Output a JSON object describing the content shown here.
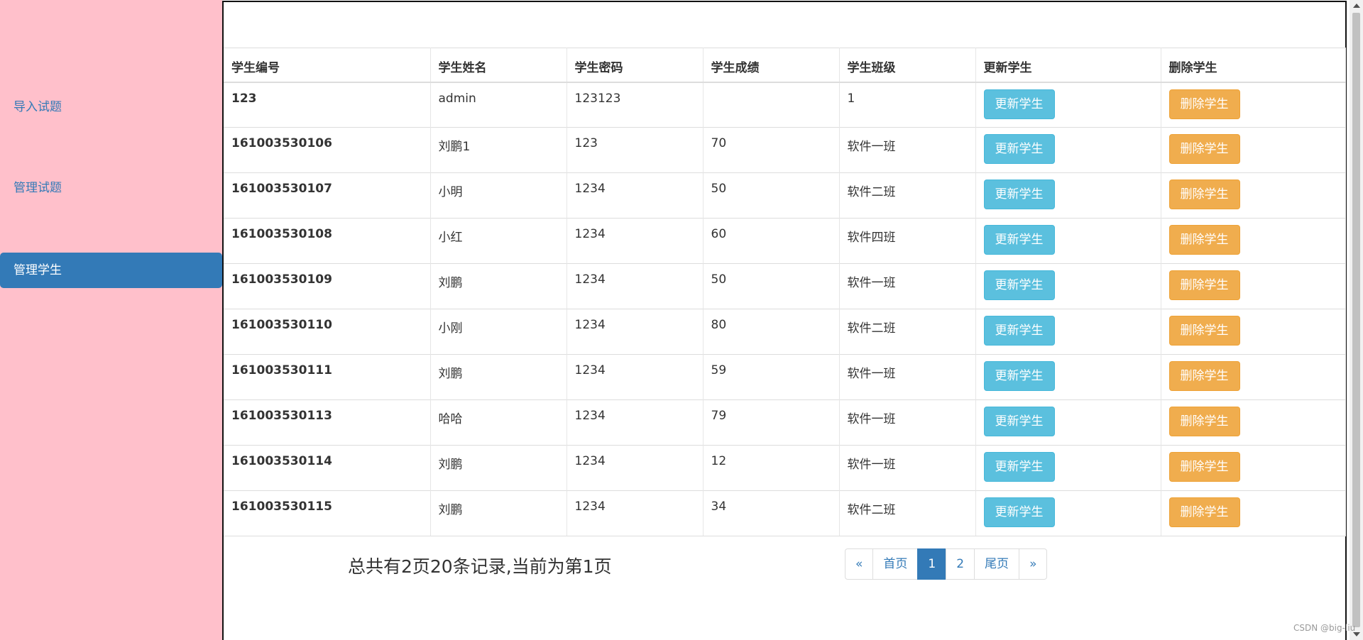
{
  "sidebar": {
    "items": [
      {
        "label": "导入试题"
      },
      {
        "label": "管理试题"
      },
      {
        "label": "管理学生",
        "active": true
      }
    ]
  },
  "table": {
    "headers": [
      "学生编号",
      "学生姓名",
      "学生密码",
      "学生成绩",
      "学生班级",
      "更新学生",
      "删除学生"
    ],
    "rows": [
      {
        "id": "123",
        "name": "admin",
        "password": "123123",
        "score": "",
        "class": "1",
        "update_label": "更新学生",
        "delete_label": "删除学生"
      },
      {
        "id": "161003530106",
        "name": "刘鹏1",
        "password": "123",
        "score": "70",
        "class": "软件一班",
        "update_label": "更新学生",
        "delete_label": "删除学生"
      },
      {
        "id": "161003530107",
        "name": "小明",
        "password": "1234",
        "score": "50",
        "class": "软件二班",
        "update_label": "更新学生",
        "delete_label": "删除学生"
      },
      {
        "id": "161003530108",
        "name": "小红",
        "password": "1234",
        "score": "60",
        "class": "软件四班",
        "update_label": "更新学生",
        "delete_label": "删除学生"
      },
      {
        "id": "161003530109",
        "name": "刘鹏",
        "password": "1234",
        "score": "50",
        "class": "软件一班",
        "update_label": "更新学生",
        "delete_label": "删除学生"
      },
      {
        "id": "161003530110",
        "name": "小刚",
        "password": "1234",
        "score": "80",
        "class": "软件二班",
        "update_label": "更新学生",
        "delete_label": "删除学生"
      },
      {
        "id": "161003530111",
        "name": "刘鹏",
        "password": "1234",
        "score": "59",
        "class": "软件一班",
        "update_label": "更新学生",
        "delete_label": "删除学生"
      },
      {
        "id": "161003530113",
        "name": "哈哈",
        "password": "1234",
        "score": "79",
        "class": "软件一班",
        "update_label": "更新学生",
        "delete_label": "删除学生"
      },
      {
        "id": "161003530114",
        "name": "刘鹏",
        "password": "1234",
        "score": "12",
        "class": "软件一班",
        "update_label": "更新学生",
        "delete_label": "删除学生"
      },
      {
        "id": "161003530115",
        "name": "刘鹏",
        "password": "1234",
        "score": "34",
        "class": "软件二班",
        "update_label": "更新学生",
        "delete_label": "删除学生"
      }
    ]
  },
  "summary": "总共有2页20条记录,当前为第1页",
  "pagination": {
    "items": [
      "«",
      "首页",
      "1",
      "2",
      "尾页",
      "»"
    ],
    "active": "1"
  },
  "watermark": "CSDN @big-liu",
  "colors": {
    "sidebar_bg": "#ffc0cb",
    "primary": "#337ab7",
    "info": "#5bc0de",
    "warning": "#f0ad4e"
  },
  "icons": {
    "scroll_up": "arrow-up-icon",
    "scroll_down": "arrow-down-icon"
  }
}
